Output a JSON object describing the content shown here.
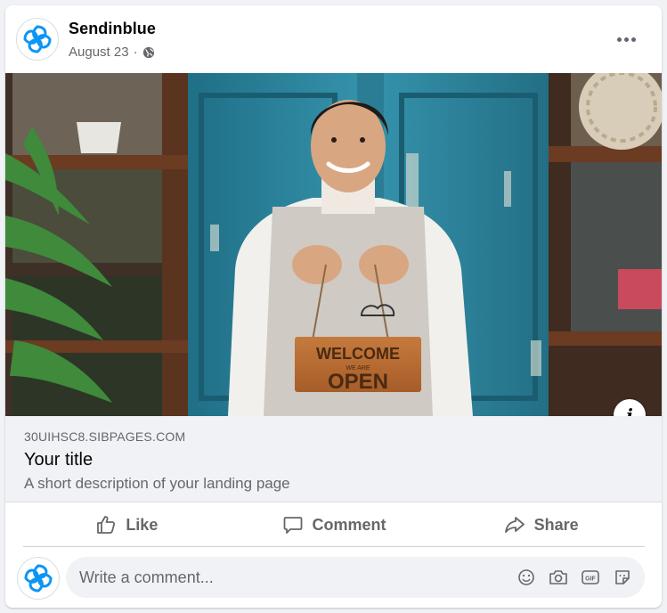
{
  "post": {
    "author": "Sendinblue",
    "date": "August 23",
    "separator": "·"
  },
  "photo": {
    "sign_line1": "WELCOME",
    "sign_line2": "WE ARE",
    "sign_line3": "OPEN"
  },
  "link_preview": {
    "domain": "30UIHSC8.SIBPAGES.COM",
    "title": "Your title",
    "description": "A short description of your landing page"
  },
  "actions": {
    "like": "Like",
    "comment": "Comment",
    "share": "Share"
  },
  "comment_box": {
    "placeholder": "Write a comment..."
  },
  "icons": {
    "avatar": "sendinblue-logo-icon",
    "privacy": "globe-icon",
    "more": "ellipsis-icon",
    "info": "info-icon",
    "like": "thumbs-up-icon",
    "comment": "speech-bubble-icon",
    "share": "share-arrow-icon",
    "emoji": "smiley-icon",
    "camera": "camera-icon",
    "gif": "gif-icon",
    "sticker": "sticker-icon"
  },
  "colors": {
    "brand_blue": "#0b96f5",
    "muted_text": "#65676b",
    "background": "#f0f2f5",
    "door_teal": "#2e8aa3"
  }
}
